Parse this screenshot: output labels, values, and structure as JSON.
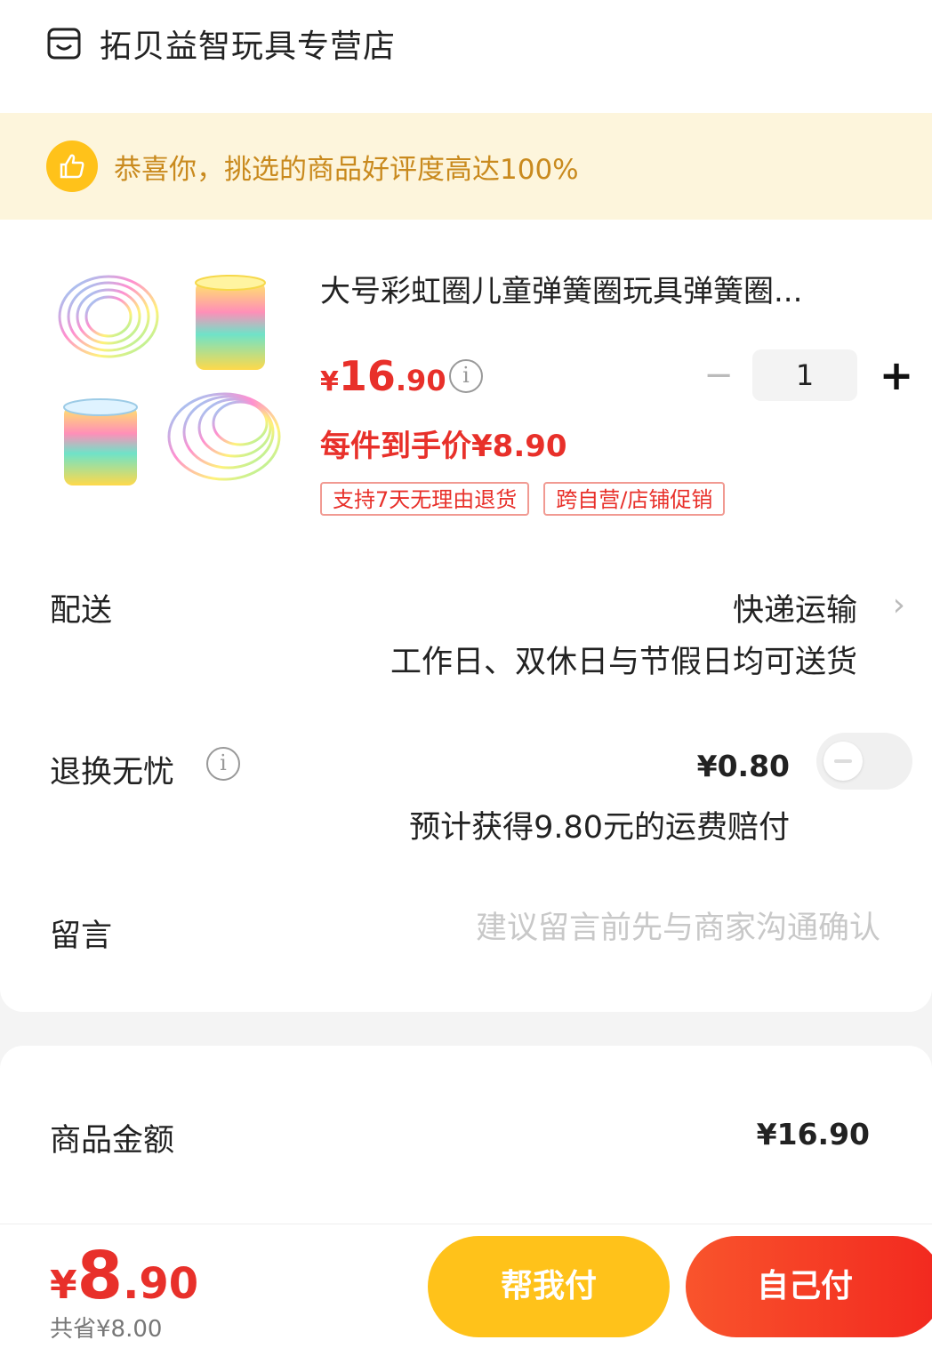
{
  "shop": {
    "name": "拓贝益智玩具专营店"
  },
  "banner": {
    "text": "恭喜你，挑选的商品好评度高达100%"
  },
  "product": {
    "title": "大号彩虹圈儿童弹簧圈玩具弹簧圈...",
    "price_yen": "¥",
    "price_int": "16",
    "price_dec": ".90",
    "unit_price": "每件到手价¥8.90",
    "quantity": "1",
    "tags": [
      "支持7天无理由退货",
      "跨自营/店铺促销"
    ]
  },
  "delivery": {
    "label": "配送",
    "method": "快递运输",
    "note": "工作日、双休日与节假日均可送货"
  },
  "return_insurance": {
    "label": "退换无忧",
    "price": "¥0.80",
    "note": "预计获得9.80元的运费赔付",
    "enabled": false
  },
  "message": {
    "label": "留言",
    "placeholder": "建议留言前先与商家沟通确认"
  },
  "summary": {
    "amount_label": "商品金额",
    "amount_value": "¥16.90"
  },
  "footer": {
    "total_yen": "¥",
    "total_int": "8",
    "total_dec": ".90",
    "saved": "共省¥8.00",
    "help_pay": "帮我付",
    "self_pay": "自己付"
  },
  "colors": {
    "accent_red": "#e8302a",
    "accent_yellow": "#ffc21a",
    "banner_bg": "#fdf5dc",
    "banner_text": "#c98a1e"
  }
}
